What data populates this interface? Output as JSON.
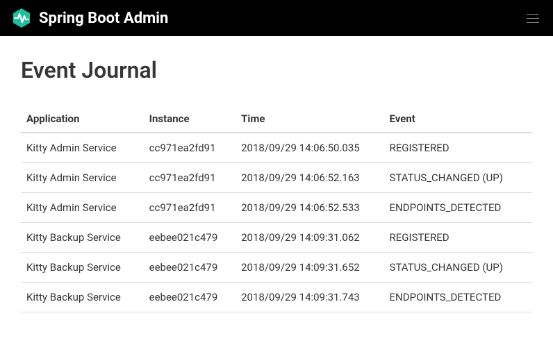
{
  "navbar": {
    "title": "Spring Boot Admin"
  },
  "page": {
    "title": "Event Journal"
  },
  "table": {
    "headers": {
      "application": "Application",
      "instance": "Instance",
      "time": "Time",
      "event": "Event"
    },
    "rows": [
      {
        "application": "Kitty Admin Service",
        "instance": "cc971ea2fd91",
        "time": "2018/09/29 14:06:50.035",
        "event": "REGISTERED"
      },
      {
        "application": "Kitty Admin Service",
        "instance": "cc971ea2fd91",
        "time": "2018/09/29 14:06:52.163",
        "event": "STATUS_CHANGED (UP)"
      },
      {
        "application": "Kitty Admin Service",
        "instance": "cc971ea2fd91",
        "time": "2018/09/29 14:06:52.533",
        "event": "ENDPOINTS_DETECTED"
      },
      {
        "application": "Kitty Backup Service",
        "instance": "eebee021c479",
        "time": "2018/09/29 14:09:31.062",
        "event": "REGISTERED"
      },
      {
        "application": "Kitty Backup Service",
        "instance": "eebee021c479",
        "time": "2018/09/29 14:09:31.652",
        "event": "STATUS_CHANGED (UP)"
      },
      {
        "application": "Kitty Backup Service",
        "instance": "eebee021c479",
        "time": "2018/09/29 14:09:31.743",
        "event": "ENDPOINTS_DETECTED"
      }
    ]
  }
}
